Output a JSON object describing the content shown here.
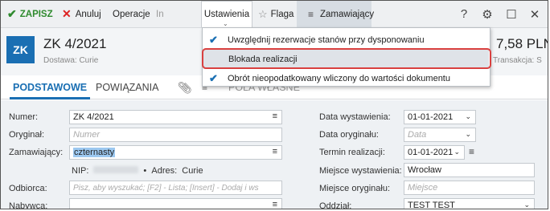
{
  "toolbar": {
    "save_label": "ZAPISZ",
    "cancel_label": "Anuluj",
    "operations_label": "Operacje",
    "hidden_label": "In",
    "settings_label": "Ustawienia",
    "flag_label": "Flaga",
    "ordering_label": "Zamawiający",
    "help_glyph": "?",
    "gear_glyph": "⚙",
    "window_glyph": "☐",
    "close_glyph": "✕"
  },
  "settings_menu": {
    "items": [
      {
        "label": "Uwzględnij rezerwacje stanów przy dysponowaniu",
        "checked": true
      },
      {
        "label": "Blokada realizacji",
        "checked": false
      },
      {
        "label": "Obrót nieopodatkowany wliczony do wartości dokumentu",
        "checked": true
      }
    ]
  },
  "header": {
    "badge": "ZK",
    "title": "ZK 4/2021",
    "subtitle": "Dostawa: Curie",
    "amount": "7,58 PLN",
    "transaction": "Transakcja: S"
  },
  "tabs": {
    "basic": "PODSTAWOWE",
    "relations": "POWIĄZANIA",
    "own_fields": "POLA WŁASNE"
  },
  "form_left": {
    "number_label": "Numer:",
    "number_value": "ZK 4/2021",
    "original_label": "Oryginał:",
    "original_placeholder": "Numer",
    "orderer_label": "Zamawiający:",
    "orderer_value": "czternasty",
    "nip_label": "NIP:",
    "address_label": "Adres:",
    "address_value": "Curie",
    "recipient_label": "Odbiorca:",
    "recipient_placeholder": "Pisz, aby wyszukać; [F2] - Lista; [Insert] - Dodaj i ws",
    "buyer_label": "Nabywca:"
  },
  "form_right": {
    "issue_date_label": "Data wystawienia:",
    "issue_date_value": "01-01-2021",
    "original_date_label": "Data oryginału:",
    "original_date_placeholder": "Data",
    "due_label": "Termin realizacji:",
    "due_value": "01-01-2021",
    "issue_place_label": "Miejsce wystawienia:",
    "issue_place_value": "Wrocław",
    "original_place_label": "Miejsce oryginału:",
    "original_place_placeholder": "Miejsce",
    "branch_label": "Oddział:",
    "branch_value": "TEST  TEST"
  },
  "colors": {
    "accent": "#1a6fb3",
    "save_green": "#2e8a2e",
    "highlight_ring": "#d9403f"
  }
}
